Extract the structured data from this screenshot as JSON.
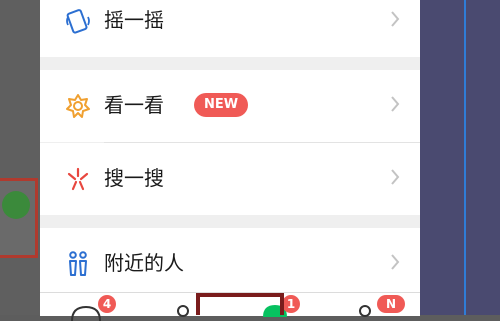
{
  "menu": [
    {
      "label": "摇一摇",
      "icon": "shake-icon"
    },
    {
      "label": "看一看",
      "icon": "top-stories-icon",
      "badge": "NEW"
    },
    {
      "label": "搜一搜",
      "icon": "search-icon"
    },
    {
      "label": "附近的人",
      "icon": "people-nearby-icon"
    }
  ],
  "tabbar": {
    "tabs": [
      {
        "icon": "chats-icon",
        "badge": "4"
      },
      {
        "icon": "contacts-icon"
      },
      {
        "icon": "discover-icon",
        "badge": "1"
      },
      {
        "icon": "me-icon",
        "badge": "N"
      }
    ]
  },
  "colors": {
    "badge": "#f05a56",
    "highlight": "#7a1c1c",
    "accent_green": "#07c160"
  }
}
